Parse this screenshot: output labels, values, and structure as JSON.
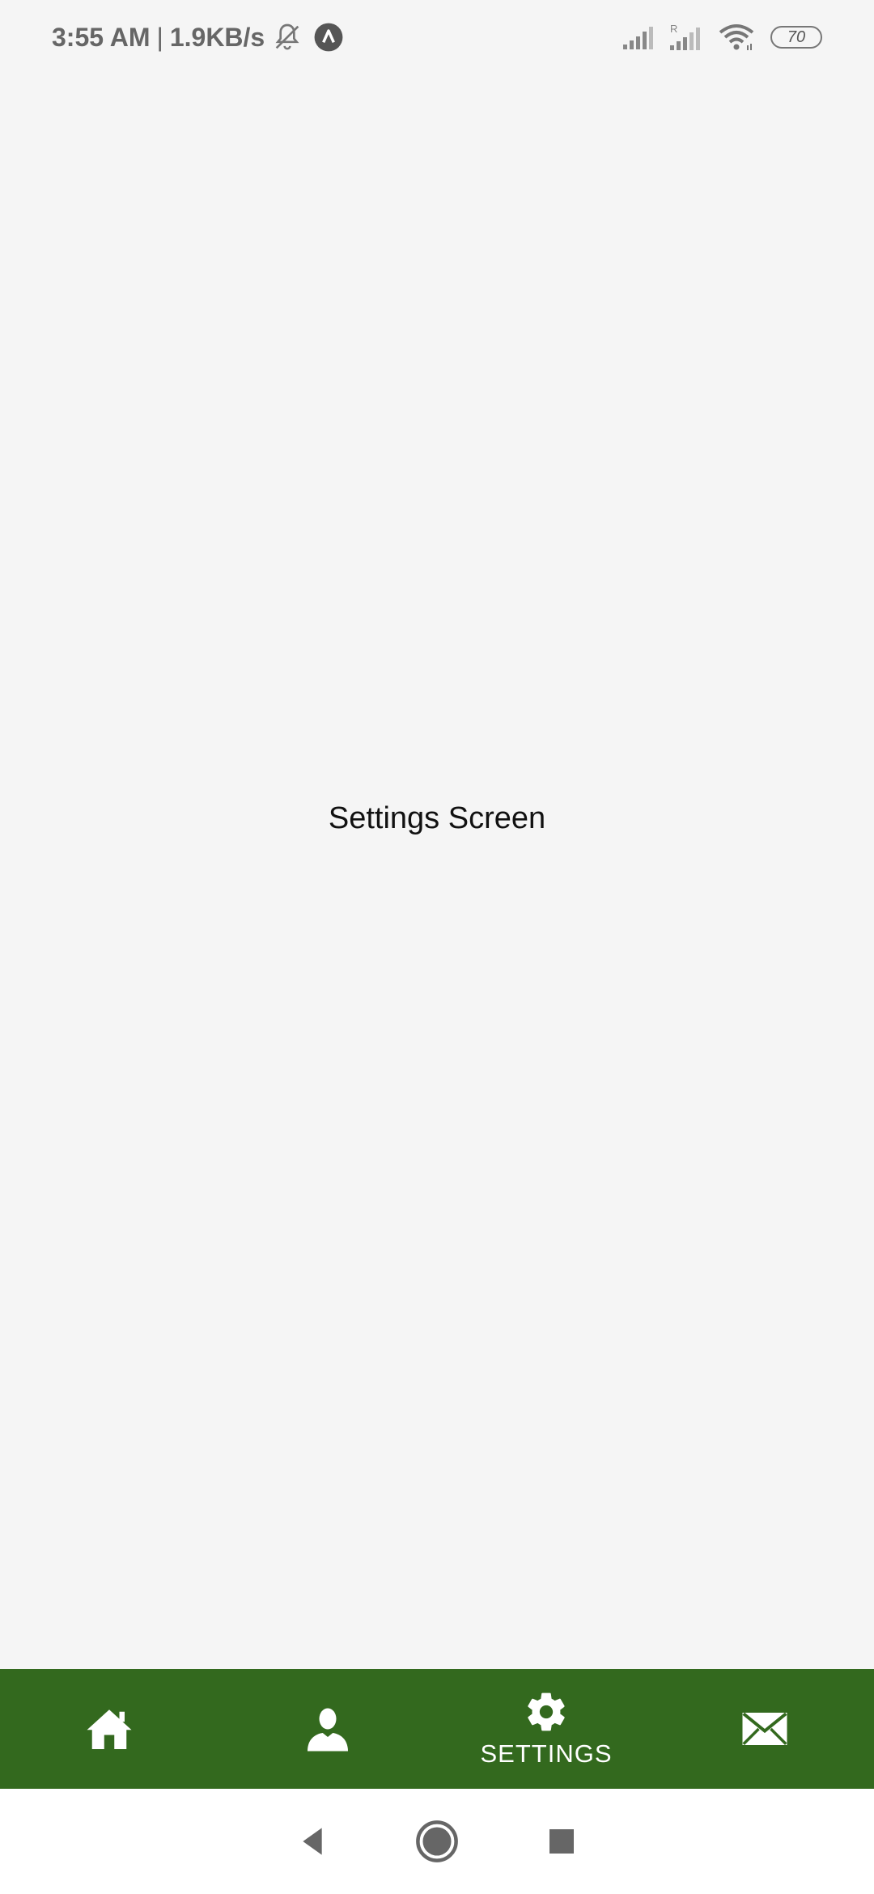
{
  "status_bar": {
    "time": "3:55 AM",
    "separator": "|",
    "net_speed": "1.9KB/s",
    "battery": "70",
    "roaming_label": "R"
  },
  "main": {
    "title": "Settings Screen"
  },
  "tab_bar": {
    "background_color": "#33691e",
    "tabs": [
      {
        "icon": "home-icon",
        "label": "",
        "active": false
      },
      {
        "icon": "person-icon",
        "label": "",
        "active": false
      },
      {
        "icon": "gear-icon",
        "label": "SETTINGS",
        "active": true
      },
      {
        "icon": "mail-icon",
        "label": "",
        "active": false
      }
    ]
  },
  "nav_bar": {
    "buttons": [
      "back-icon",
      "home-circle-icon",
      "recents-icon"
    ]
  }
}
